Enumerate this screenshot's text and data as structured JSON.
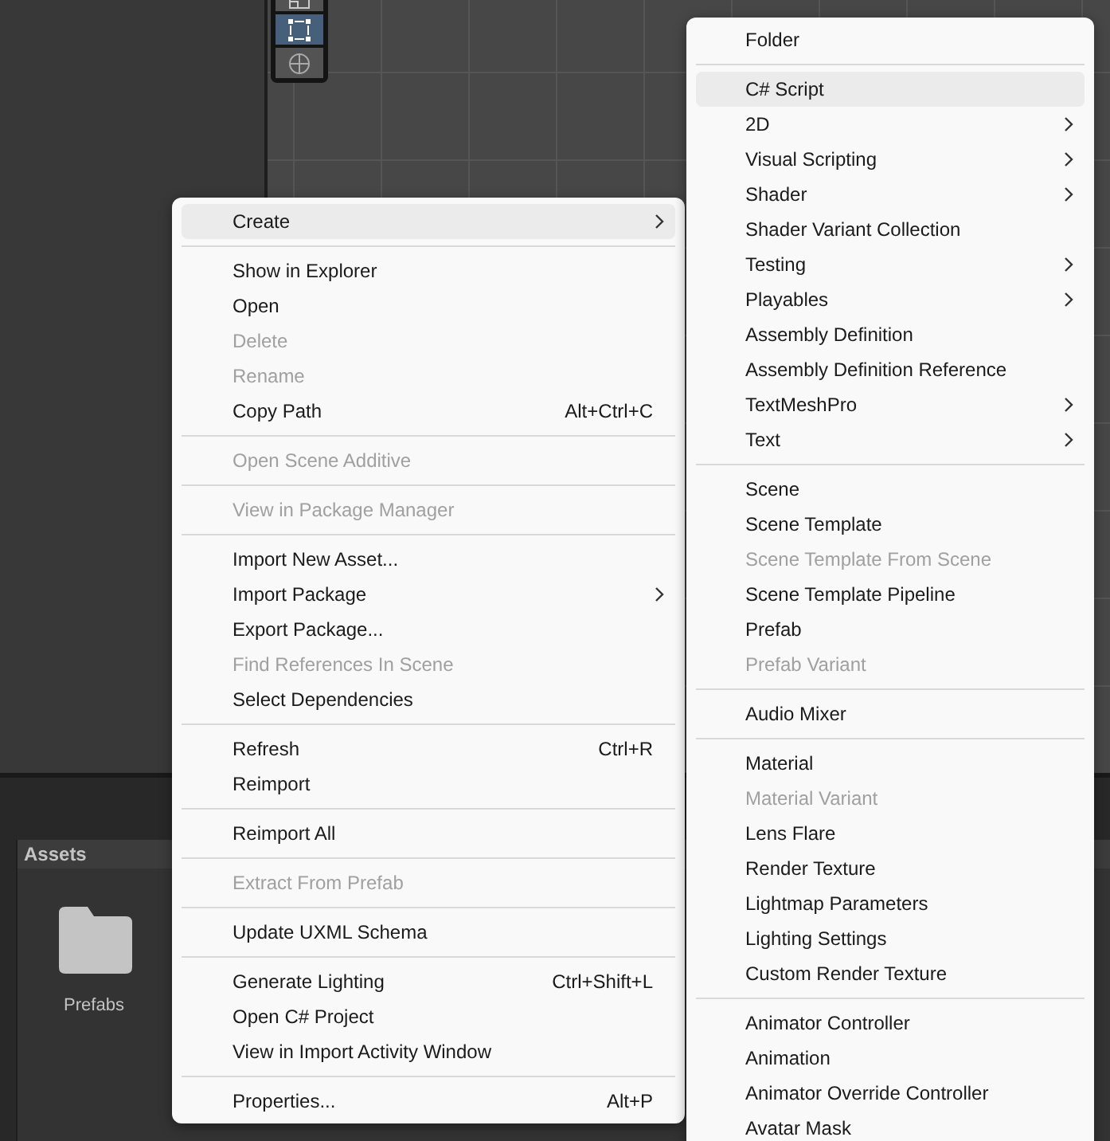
{
  "scene_toolbar": {
    "tools": [
      {
        "selected": false
      },
      {
        "selected": true
      },
      {
        "selected": false
      }
    ]
  },
  "project_panel": {
    "title": "Assets",
    "items": [
      {
        "label": "Prefabs"
      }
    ]
  },
  "context_menu": {
    "sections": [
      {
        "items": [
          {
            "label": "Create",
            "submenu": true,
            "disabled": false,
            "highlighted": true
          }
        ]
      },
      {
        "items": [
          {
            "label": "Show in Explorer",
            "submenu": false,
            "disabled": false,
            "highlighted": false
          },
          {
            "label": "Open",
            "submenu": false,
            "disabled": false,
            "highlighted": false
          },
          {
            "label": "Delete",
            "submenu": false,
            "disabled": true,
            "highlighted": false
          },
          {
            "label": "Rename",
            "submenu": false,
            "disabled": true,
            "highlighted": false
          },
          {
            "label": "Copy Path",
            "shortcut": "Alt+Ctrl+C",
            "submenu": false,
            "disabled": false,
            "highlighted": false
          }
        ]
      },
      {
        "items": [
          {
            "label": "Open Scene Additive",
            "submenu": false,
            "disabled": true,
            "highlighted": false
          }
        ]
      },
      {
        "items": [
          {
            "label": "View in Package Manager",
            "submenu": false,
            "disabled": true,
            "highlighted": false
          }
        ]
      },
      {
        "items": [
          {
            "label": "Import New Asset...",
            "submenu": false,
            "disabled": false,
            "highlighted": false
          },
          {
            "label": "Import Package",
            "submenu": true,
            "disabled": false,
            "highlighted": false
          },
          {
            "label": "Export Package...",
            "submenu": false,
            "disabled": false,
            "highlighted": false
          },
          {
            "label": "Find References In Scene",
            "submenu": false,
            "disabled": true,
            "highlighted": false
          },
          {
            "label": "Select Dependencies",
            "submenu": false,
            "disabled": false,
            "highlighted": false
          }
        ]
      },
      {
        "items": [
          {
            "label": "Refresh",
            "shortcut": "Ctrl+R",
            "submenu": false,
            "disabled": false,
            "highlighted": false
          },
          {
            "label": "Reimport",
            "submenu": false,
            "disabled": false,
            "highlighted": false
          }
        ]
      },
      {
        "items": [
          {
            "label": "Reimport All",
            "submenu": false,
            "disabled": false,
            "highlighted": false
          }
        ]
      },
      {
        "items": [
          {
            "label": "Extract From Prefab",
            "submenu": false,
            "disabled": true,
            "highlighted": false
          }
        ]
      },
      {
        "items": [
          {
            "label": "Update UXML Schema",
            "submenu": false,
            "disabled": false,
            "highlighted": false
          }
        ]
      },
      {
        "items": [
          {
            "label": "Generate Lighting",
            "shortcut": "Ctrl+Shift+L",
            "submenu": false,
            "disabled": false,
            "highlighted": false
          },
          {
            "label": "Open C# Project",
            "submenu": false,
            "disabled": false,
            "highlighted": false
          },
          {
            "label": "View in Import Activity Window",
            "submenu": false,
            "disabled": false,
            "highlighted": false
          }
        ]
      },
      {
        "items": [
          {
            "label": "Properties...",
            "shortcut": "Alt+P",
            "submenu": false,
            "disabled": false,
            "highlighted": false
          }
        ]
      }
    ]
  },
  "create_submenu": {
    "sections": [
      {
        "items": [
          {
            "label": "Folder",
            "submenu": false,
            "disabled": false,
            "highlighted": false
          }
        ]
      },
      {
        "items": [
          {
            "label": "C# Script",
            "submenu": false,
            "disabled": false,
            "highlighted": true
          },
          {
            "label": "2D",
            "submenu": true,
            "disabled": false,
            "highlighted": false
          },
          {
            "label": "Visual Scripting",
            "submenu": true,
            "disabled": false,
            "highlighted": false
          },
          {
            "label": "Shader",
            "submenu": true,
            "disabled": false,
            "highlighted": false
          },
          {
            "label": "Shader Variant Collection",
            "submenu": false,
            "disabled": false,
            "highlighted": false
          },
          {
            "label": "Testing",
            "submenu": true,
            "disabled": false,
            "highlighted": false
          },
          {
            "label": "Playables",
            "submenu": true,
            "disabled": false,
            "highlighted": false
          },
          {
            "label": "Assembly Definition",
            "submenu": false,
            "disabled": false,
            "highlighted": false
          },
          {
            "label": "Assembly Definition Reference",
            "submenu": false,
            "disabled": false,
            "highlighted": false
          },
          {
            "label": "TextMeshPro",
            "submenu": true,
            "disabled": false,
            "highlighted": false
          },
          {
            "label": "Text",
            "submenu": true,
            "disabled": false,
            "highlighted": false
          }
        ]
      },
      {
        "items": [
          {
            "label": "Scene",
            "submenu": false,
            "disabled": false,
            "highlighted": false
          },
          {
            "label": "Scene Template",
            "submenu": false,
            "disabled": false,
            "highlighted": false
          },
          {
            "label": "Scene Template From Scene",
            "submenu": false,
            "disabled": true,
            "highlighted": false
          },
          {
            "label": "Scene Template Pipeline",
            "submenu": false,
            "disabled": false,
            "highlighted": false
          },
          {
            "label": "Prefab",
            "submenu": false,
            "disabled": false,
            "highlighted": false
          },
          {
            "label": "Prefab Variant",
            "submenu": false,
            "disabled": true,
            "highlighted": false
          }
        ]
      },
      {
        "items": [
          {
            "label": "Audio Mixer",
            "submenu": false,
            "disabled": false,
            "highlighted": false
          }
        ]
      },
      {
        "items": [
          {
            "label": "Material",
            "submenu": false,
            "disabled": false,
            "highlighted": false
          },
          {
            "label": "Material Variant",
            "submenu": false,
            "disabled": true,
            "highlighted": false
          },
          {
            "label": "Lens Flare",
            "submenu": false,
            "disabled": false,
            "highlighted": false
          },
          {
            "label": "Render Texture",
            "submenu": false,
            "disabled": false,
            "highlighted": false
          },
          {
            "label": "Lightmap Parameters",
            "submenu": false,
            "disabled": false,
            "highlighted": false
          },
          {
            "label": "Lighting Settings",
            "submenu": false,
            "disabled": false,
            "highlighted": false
          },
          {
            "label": "Custom Render Texture",
            "submenu": false,
            "disabled": false,
            "highlighted": false
          }
        ]
      },
      {
        "items": [
          {
            "label": "Animator Controller",
            "submenu": false,
            "disabled": false,
            "highlighted": false
          },
          {
            "label": "Animation",
            "submenu": false,
            "disabled": false,
            "highlighted": false
          },
          {
            "label": "Animator Override Controller",
            "submenu": false,
            "disabled": false,
            "highlighted": false
          },
          {
            "label": "Avatar Mask",
            "submenu": false,
            "disabled": false,
            "highlighted": false
          }
        ]
      }
    ]
  }
}
